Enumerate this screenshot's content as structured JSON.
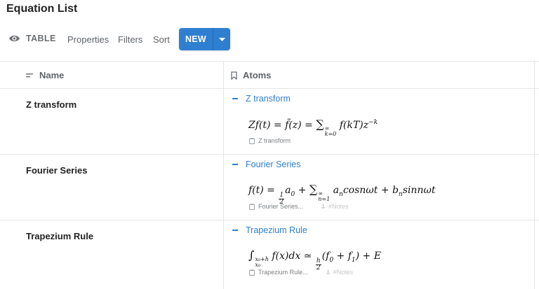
{
  "page": {
    "title": "Equation List"
  },
  "toolbar": {
    "view_label": "TABLE",
    "properties_label": "Properties",
    "filters_label": "Filters",
    "sort_label": "Sort",
    "new_label": "NEW"
  },
  "columns": {
    "name_label": "Name",
    "atoms_label": "Atoms"
  },
  "rows": [
    {
      "name": "Z transform",
      "atom_title": "Z transform",
      "atom_meta": "Z transform",
      "notes": ""
    },
    {
      "name": "Fourier Series",
      "atom_title": "Fourier Series",
      "atom_meta": "Fourier Series...",
      "notes": "#Notes"
    },
    {
      "name": "Trapezium Rule",
      "atom_title": "Trapezium Rule",
      "atom_meta": "Trapezium Rule...",
      "notes": "#Notes"
    }
  ],
  "colors": {
    "accent": "#2f7fd1",
    "border": "#e6e6e6"
  },
  "icons": {
    "view": "eye-icon",
    "name_col": "text-lines-icon",
    "atoms_col": "bookmark-icon",
    "dropdown": "chevron-down-icon",
    "atom_file": "clipboard-icon",
    "notes": "anchor-icon"
  }
}
